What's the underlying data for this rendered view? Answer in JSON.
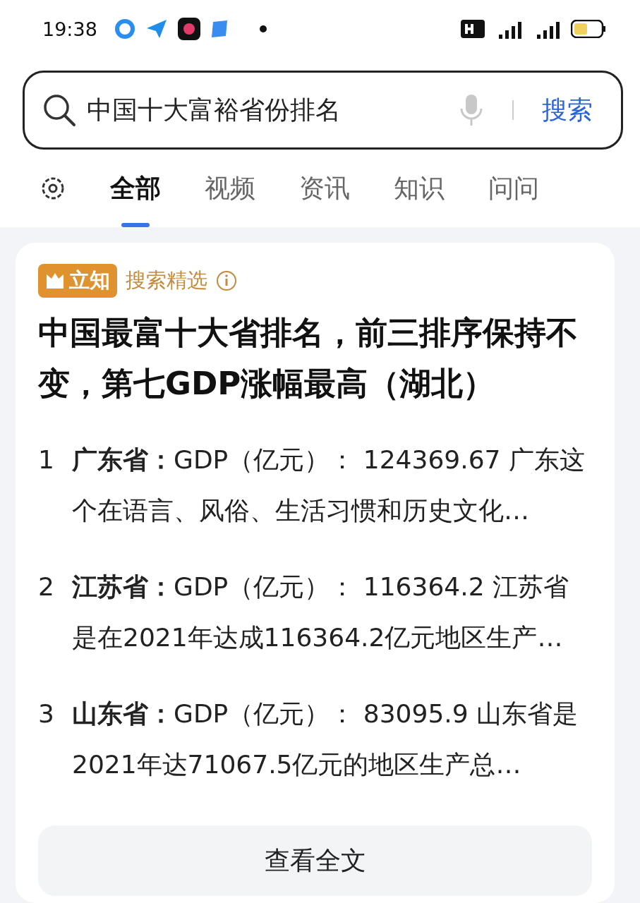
{
  "status_bar": {
    "time": "19:38"
  },
  "search": {
    "value": "中国十大富裕省份排名",
    "button": "搜索"
  },
  "tabs": [
    {
      "label": "全部",
      "selected": true
    },
    {
      "label": "视频",
      "selected": false
    },
    {
      "label": "资讯",
      "selected": false
    },
    {
      "label": "知识",
      "selected": false
    },
    {
      "label": "问问",
      "selected": false
    }
  ],
  "card": {
    "badge": "立知",
    "source": "搜索精选",
    "title": "中国最富十大省排名，前三排序保持不变，第七GDP涨幅最高（湖北）",
    "items": [
      {
        "number": "1",
        "text": "**广东省：**GDP（亿元）： 124369.67 广东这个在语言、风俗、生活习惯和历史文化…"
      },
      {
        "number": "2",
        "text": "**江苏省：**GDP（亿元）： 116364.2 江苏省是在2021年达成116364.2亿元地区生产…"
      },
      {
        "number": "3",
        "text": "**山东省：**GDP（亿元）： 83095.9 山东省是2021年达71067.5亿元的地区生产总…"
      }
    ],
    "more_button": "查看全文"
  }
}
